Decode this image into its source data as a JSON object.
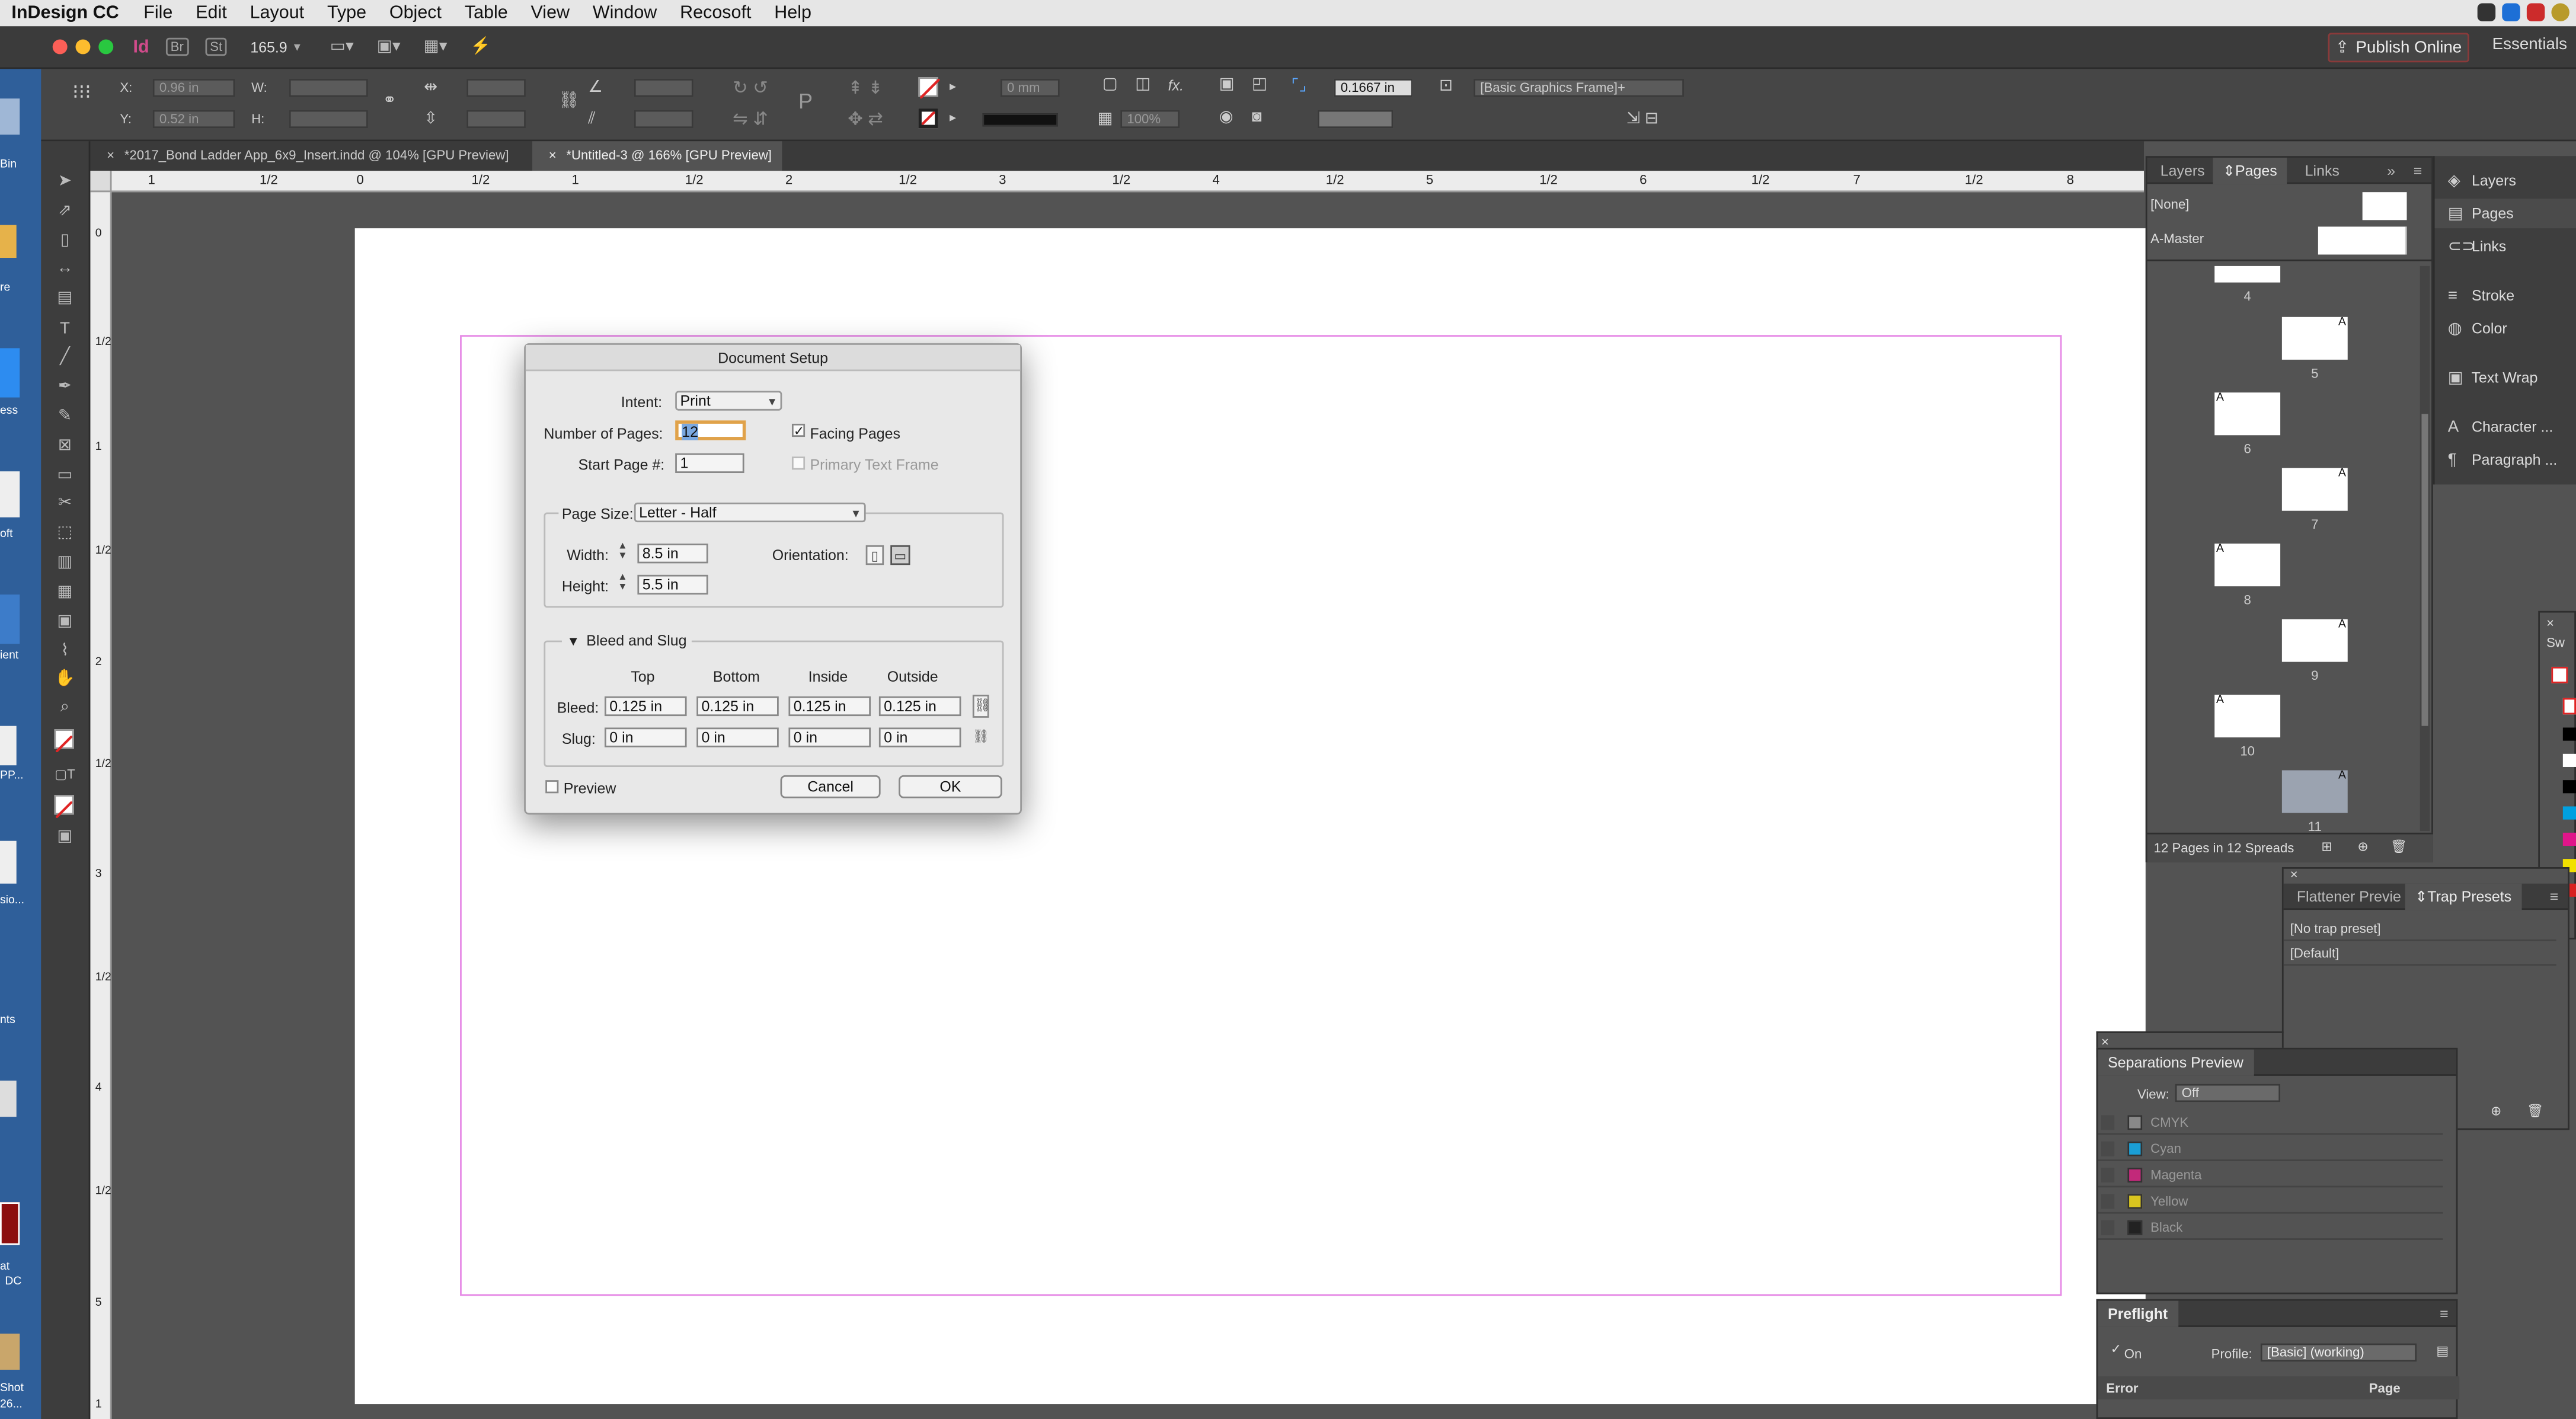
{
  "menubar": {
    "app_name": "InDesign CC",
    "items": [
      "File",
      "Edit",
      "Layout",
      "Type",
      "Object",
      "Table",
      "View",
      "Window",
      "Recosoft",
      "Help"
    ]
  },
  "appbar": {
    "app_icon": "Id",
    "bridge": "Br",
    "stock": "St",
    "zoom": "165.9",
    "publish_label": "Publish Online",
    "workspace": "Essentials"
  },
  "control": {
    "x_label": "X:",
    "x_value": "0.96 in",
    "y_label": "Y:",
    "y_value": "0.52 in",
    "w_label": "W:",
    "h_label": "H:",
    "stroke_weight": "0 mm",
    "opacity": "100%",
    "fx": "fx.",
    "ref_value": "0.1667 in",
    "object_style": "[Basic Graphics Frame]+"
  },
  "tabs": [
    {
      "label": "*2017_Bond Ladder App_6x9_Insert.indd @ 104% [GPU Preview]"
    },
    {
      "label": "*Untitled-3 @ 166% [GPU Preview]"
    }
  ],
  "ruler": {
    "h_ticks": [
      "1",
      "1/2",
      "0",
      "1/2",
      "1",
      "1/2",
      "2",
      "1/2",
      "3",
      "1/2",
      "4",
      "1/2",
      "5",
      "1/2",
      "6",
      "1/2",
      "7",
      "1/2",
      "8"
    ],
    "v_ticks": [
      "0",
      "1/2",
      "1",
      "1/2",
      "2",
      "1/2",
      "3",
      "1/2",
      "4",
      "1/2",
      "5",
      "1"
    ]
  },
  "dialog": {
    "title": "Document Setup",
    "intent_label": "Intent:",
    "intent_value": "Print",
    "num_pages_label": "Number of Pages:",
    "num_pages_value": "12",
    "facing_pages_label": "Facing Pages",
    "facing_pages_checked": true,
    "start_page_label": "Start Page #:",
    "start_page_value": "1",
    "primary_text_frame_label": "Primary Text Frame",
    "page_size_label": "Page Size:",
    "page_size_value": "Letter - Half",
    "width_label": "Width:",
    "width_value": "8.5 in",
    "height_label": "Height:",
    "height_value": "5.5 in",
    "orientation_label": "Orientation:",
    "bleed_slug_label": "Bleed and Slug",
    "col_top": "Top",
    "col_bottom": "Bottom",
    "col_inside": "Inside",
    "col_outside": "Outside",
    "bleed_label": "Bleed:",
    "bleed_values": [
      "0.125 in",
      "0.125 in",
      "0.125 in",
      "0.125 in"
    ],
    "slug_label": "Slug:",
    "slug_values": [
      "0 in",
      "0 in",
      "0 in",
      "0 in"
    ],
    "preview_label": "Preview",
    "cancel_label": "Cancel",
    "ok_label": "OK"
  },
  "pages_panel": {
    "tabs": [
      "Layers",
      "Pages",
      "Links"
    ],
    "active_tab": "Pages",
    "masters": [
      "[None]",
      "A-Master"
    ],
    "pages": [
      {
        "num": "4",
        "side": "left",
        "master": ""
      },
      {
        "num": "5",
        "side": "right",
        "master": "A"
      },
      {
        "num": "6",
        "side": "left",
        "master": "A"
      },
      {
        "num": "7",
        "side": "right",
        "master": "A"
      },
      {
        "num": "8",
        "side": "left",
        "master": "A"
      },
      {
        "num": "9",
        "side": "right",
        "master": "A"
      },
      {
        "num": "10",
        "side": "left",
        "master": "A"
      },
      {
        "num": "11",
        "side": "right",
        "master": "A"
      }
    ],
    "footer": "12 Pages in 12 Spreads"
  },
  "dock": {
    "items": [
      {
        "label": "Layers",
        "icon": "layers-icon"
      },
      {
        "label": "Pages",
        "icon": "pages-icon"
      },
      {
        "label": "Links",
        "icon": "links-icon"
      },
      {
        "label": "Stroke",
        "icon": "stroke-icon"
      },
      {
        "label": "Color",
        "icon": "color-icon"
      },
      {
        "label": "Text Wrap",
        "icon": "text-wrap-icon"
      },
      {
        "label": "Character ...",
        "icon": "character-icon"
      },
      {
        "label": "Paragraph ...",
        "icon": "paragraph-icon"
      }
    ]
  },
  "trap_panel": {
    "tabs": [
      "Flattener Previe",
      "Trap Presets"
    ],
    "items": [
      "[No trap preset]",
      "[Default]"
    ]
  },
  "separations": {
    "title": "Separations Preview",
    "view_label": "View:",
    "view_value": "Off",
    "rows": [
      {
        "name": "CMYK",
        "color": "#888888"
      },
      {
        "name": "Cyan",
        "color": "#1a9fd6"
      },
      {
        "name": "Magenta",
        "color": "#c2297a"
      },
      {
        "name": "Yellow",
        "color": "#d9c51f"
      },
      {
        "name": "Black",
        "color": "#222222"
      }
    ]
  },
  "preflight": {
    "title": "Preflight",
    "on_label": "On",
    "profile_label": "Profile:",
    "profile_value": "[Basic] (working)",
    "col_error": "Error",
    "col_page": "Page"
  },
  "swatches": {
    "tab": "Sw"
  },
  "desktop_labels": [
    "Bin",
    "re",
    "ess",
    "oft",
    "ient",
    "PP...",
    "sio...",
    "nts",
    "at",
    "DC",
    "Shot",
    "26..."
  ]
}
